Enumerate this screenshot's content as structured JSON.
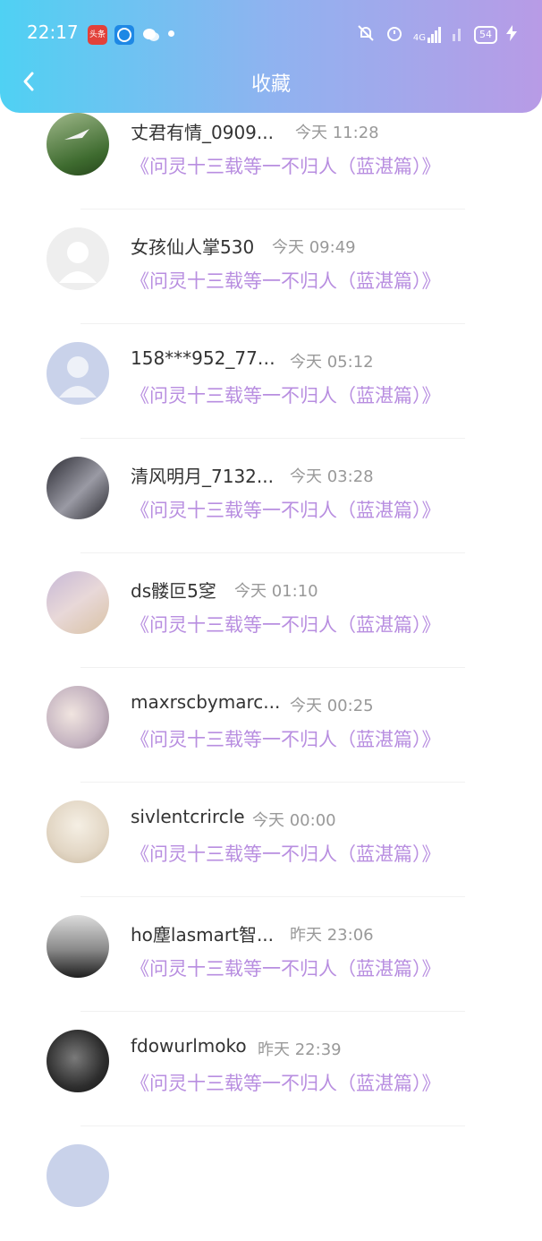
{
  "status_bar": {
    "time": "22:17",
    "app_badge": "头条",
    "signal_label": "4G",
    "battery": "54"
  },
  "header": {
    "title": "收藏"
  },
  "items": [
    {
      "name": "丈君有情_0909...",
      "time": "今天 11:28",
      "link": "《问灵十三载等一不归人（蓝湛篇）》"
    },
    {
      "name": "女孩仙人掌530",
      "time": "今天 09:49",
      "link": "《问灵十三载等一不归人（蓝湛篇）》"
    },
    {
      "name": "158***952_771...",
      "time": "今天 05:12",
      "link": "《问灵十三载等一不归人（蓝湛篇）》"
    },
    {
      "name": "清风明月_7132...",
      "time": "今天 03:28",
      "link": "《问灵十三载等一不归人（蓝湛篇）》"
    },
    {
      "name": "ds髅叵5窆",
      "time": "今天 01:10",
      "link": "《问灵十三载等一不归人（蓝湛篇）》"
    },
    {
      "name": "maxrscbymarc...",
      "time": "今天 00:25",
      "link": "《问灵十三载等一不归人（蓝湛篇）》"
    },
    {
      "name": "sivlentcrircle",
      "time": "今天 00:00",
      "link": "《问灵十三载等一不归人（蓝湛篇）》"
    },
    {
      "name": "ho塵lasmart智...",
      "time": "昨天 23:06",
      "link": "《问灵十三载等一不归人（蓝湛篇）》"
    },
    {
      "name": "fdowurlmoko",
      "time": "昨天 22:39",
      "link": "《问灵十三载等一不归人（蓝湛篇）》"
    }
  ]
}
